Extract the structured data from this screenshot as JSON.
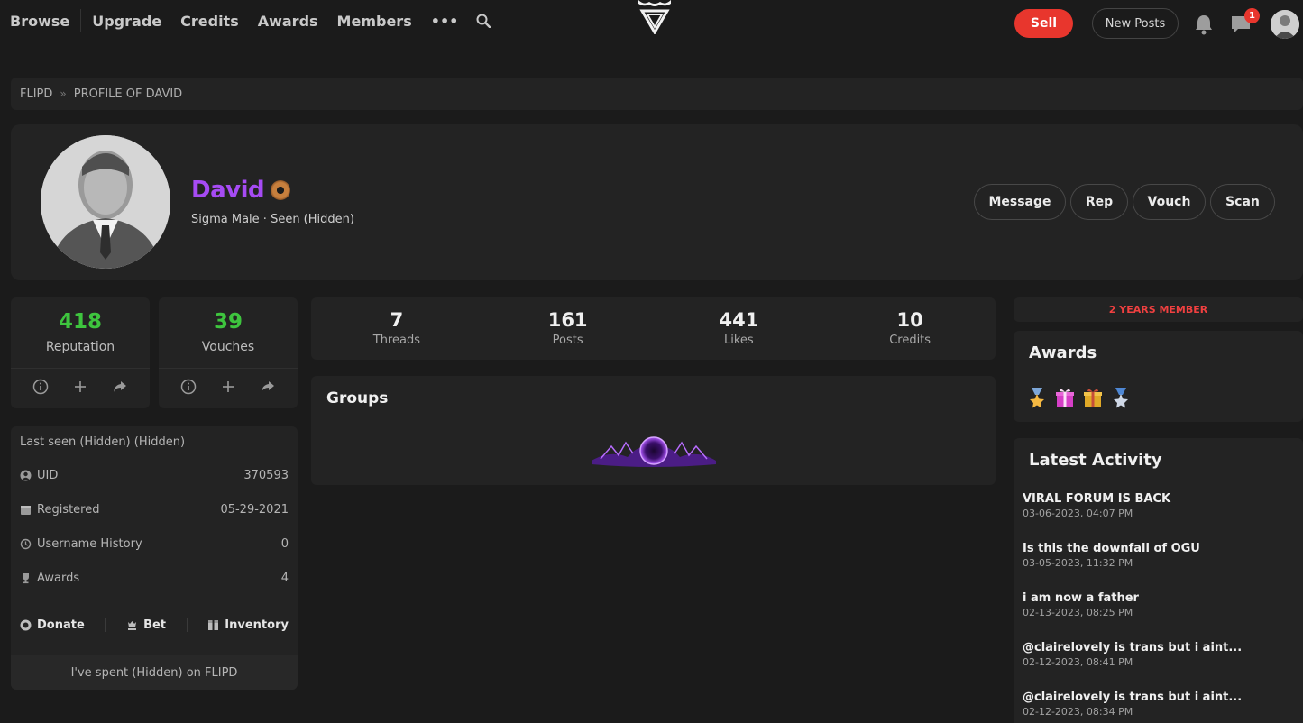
{
  "nav": {
    "links": [
      "Browse",
      "Upgrade",
      "Credits",
      "Awards",
      "Members"
    ],
    "more": "•••",
    "sell": "Sell",
    "new_posts": "New Posts",
    "notif_count": "1"
  },
  "breadcrumb": {
    "root": "FLIPD",
    "current": "PROFILE OF DAVID"
  },
  "profile": {
    "username": "David",
    "subtitle": "Sigma Male · Seen (Hidden)",
    "username_color": "#a64bf4",
    "actions": [
      "Message",
      "Rep",
      "Vouch",
      "Scan"
    ]
  },
  "stats": {
    "reputation": {
      "value": "418",
      "label": "Reputation"
    },
    "vouches": {
      "value": "39",
      "label": "Vouches"
    }
  },
  "info": {
    "last_seen": "Last seen (Hidden) (Hidden)",
    "rows": [
      {
        "label": "UID",
        "value": "370593",
        "icon": "user-circle-icon"
      },
      {
        "label": "Registered",
        "value": "05-29-2021",
        "icon": "calendar-icon"
      },
      {
        "label": "Username History",
        "value": "0",
        "icon": "history-icon"
      },
      {
        "label": "Awards",
        "value": "4",
        "icon": "trophy-icon"
      }
    ],
    "links": [
      "Donate",
      "Bet",
      "Inventory"
    ],
    "spent": "I've spent (Hidden) on FLIPD"
  },
  "counters": [
    {
      "value": "7",
      "label": "Threads"
    },
    {
      "value": "161",
      "label": "Posts"
    },
    {
      "value": "441",
      "label": "Likes"
    },
    {
      "value": "10",
      "label": "Credits"
    }
  ],
  "groups": {
    "title": "Groups"
  },
  "member_badge": "2 YEARS MEMBER",
  "awards": {
    "title": "Awards"
  },
  "activity": {
    "title": "Latest Activity",
    "items": [
      {
        "title": "VIRAL FORUM IS BACK",
        "date": "03-06-2023, 04:07 PM"
      },
      {
        "title": "Is this the downfall of OGU",
        "date": "03-05-2023, 11:32 PM"
      },
      {
        "title": "i am now a father",
        "date": "02-13-2023, 08:25 PM"
      },
      {
        "title": "@clairelovely is trans but i aint...",
        "date": "02-12-2023, 08:41 PM"
      },
      {
        "title": "@clairelovely is trans but i aint...",
        "date": "02-12-2023, 08:34 PM"
      }
    ]
  }
}
